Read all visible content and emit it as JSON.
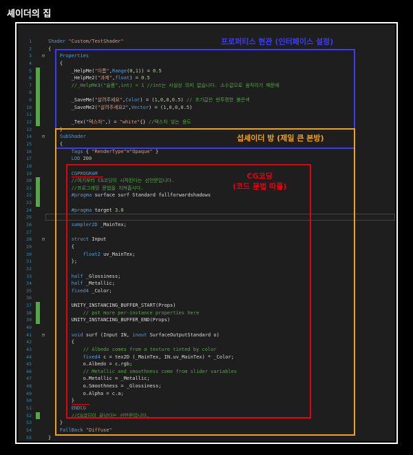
{
  "page": {
    "title": "셰이더의 집"
  },
  "annotations": {
    "properties_label": "프로퍼티스 현관 (인터페이스 설정)",
    "subshader_label": "섭셰이더 방 (제일 큰 본방)",
    "cg_label_line1": "CG코딩",
    "cg_label_line2": "(코드 문법 따름)"
  },
  "editor": {
    "lines": [
      {
        "n": "1",
        "t": "Shader \"Custom/TestShader\""
      },
      {
        "n": "2",
        "t": "{"
      },
      {
        "n": "3",
        "t": "    Properties"
      },
      {
        "n": "4",
        "t": "    {"
      },
      {
        "n": "5",
        "t": "        _HelpMe(\"이름\",Range(0,1)) = 0.5"
      },
      {
        "n": "6",
        "t": "        _HelpMe2(\"과제\",float) = 0.5"
      },
      {
        "n": "7",
        "t": "        //_HelpMe3(\"슬픔\",int) = 1 //int는 사실상 의미 없습니다. 소수값으로 움직이기 때문에"
      },
      {
        "n": "8",
        "t": ""
      },
      {
        "n": "9",
        "t": "        _SaveMe(\"살려주세요\",Color) = (1,0,0,0.5) // 초기값은 반투명한 붉은색"
      },
      {
        "n": "10",
        "t": "        _SaveMe2(\"살려주세요2\",Vector) = (1,0,0,0.5)"
      },
      {
        "n": "11",
        "t": ""
      },
      {
        "n": "12",
        "t": "        _Tex(\"텍스처\",2D) = \"white\"{} //텍스처 넣는 용도"
      },
      {
        "n": "13",
        "t": "    }"
      },
      {
        "n": "14",
        "t": "    SubShader"
      },
      {
        "n": "15",
        "t": "    {"
      },
      {
        "n": "16",
        "t": "        Tags { \"RenderType\"=\"Opaque\" }"
      },
      {
        "n": "17",
        "t": "        LOD 200"
      },
      {
        "n": "18",
        "t": ""
      },
      {
        "n": "19",
        "t": "        CGPROGRAM"
      },
      {
        "n": "20",
        "t": "        //여기부터 CG코딩이 시작된다는 선언문입니다."
      },
      {
        "n": "21",
        "t": "        //프로그래밍 문법을 지켜줍시다."
      },
      {
        "n": "22",
        "t": "        #pragma surface surf Standard fullforwardshadows"
      },
      {
        "n": "23",
        "t": ""
      },
      {
        "n": "24",
        "t": "        #pragma target 3.0"
      },
      {
        "n": "25",
        "t": ""
      },
      {
        "n": "26",
        "t": "        sampler2D _MainTex;"
      },
      {
        "n": "27",
        "t": ""
      },
      {
        "n": "28",
        "t": "        struct Input"
      },
      {
        "n": "29",
        "t": "        {"
      },
      {
        "n": "30",
        "t": "            float2 uv_MainTex;"
      },
      {
        "n": "31",
        "t": "        };"
      },
      {
        "n": "32",
        "t": ""
      },
      {
        "n": "33",
        "t": "        half _Glossiness;"
      },
      {
        "n": "34",
        "t": "        half _Metallic;"
      },
      {
        "n": "35",
        "t": "        fixed4 _Color;"
      },
      {
        "n": "36",
        "t": ""
      },
      {
        "n": "37",
        "t": "        UNITY_INSTANCING_BUFFER_START(Props)"
      },
      {
        "n": "38",
        "t": "            // put more per-instance properties here"
      },
      {
        "n": "39",
        "t": "        UNITY_INSTANCING_BUFFER_END(Props)"
      },
      {
        "n": "40",
        "t": ""
      },
      {
        "n": "41",
        "t": "        void surf (Input IN, inout SurfaceOutputStandard o)"
      },
      {
        "n": "42",
        "t": "        {"
      },
      {
        "n": "43",
        "t": "            // Albedo comes from a texture tinted by color"
      },
      {
        "n": "44",
        "t": "            fixed4 c = tex2D (_MainTex, IN.uv_MainTex) * _Color;"
      },
      {
        "n": "45",
        "t": "            o.Albedo = c.rgb;"
      },
      {
        "n": "46",
        "t": "            // Metallic and smoothness come from slider variables"
      },
      {
        "n": "47",
        "t": "            o.Metallic = _Metallic;"
      },
      {
        "n": "48",
        "t": "            o.Smoothness = _Glossiness;"
      },
      {
        "n": "49",
        "t": "            o.Alpha = c.a;"
      },
      {
        "n": "50",
        "t": "        }"
      },
      {
        "n": "51",
        "t": "        ENDCG"
      },
      {
        "n": "52",
        "t": "        //CG코딩이 끝났다는 선언문입니다."
      },
      {
        "n": "53",
        "t": "    }"
      },
      {
        "n": "54",
        "t": "    FallBack \"Diffuse\""
      },
      {
        "n": "55",
        "t": "}"
      }
    ],
    "green_gutter_lines": [
      5,
      6,
      7,
      8,
      9,
      10,
      11,
      12,
      20,
      21,
      22,
      23,
      37,
      38,
      39,
      52
    ],
    "fold_lines": {
      "3": "⊟",
      "14": "⊟",
      "28": "⊟",
      "41": "⊟"
    },
    "highlighted_line": 25,
    "colors": {
      "blue_box": "#3b3bff",
      "orange_box": "#f3a21b",
      "red_box": "#e8000b",
      "background": "#1e1e1e"
    }
  }
}
